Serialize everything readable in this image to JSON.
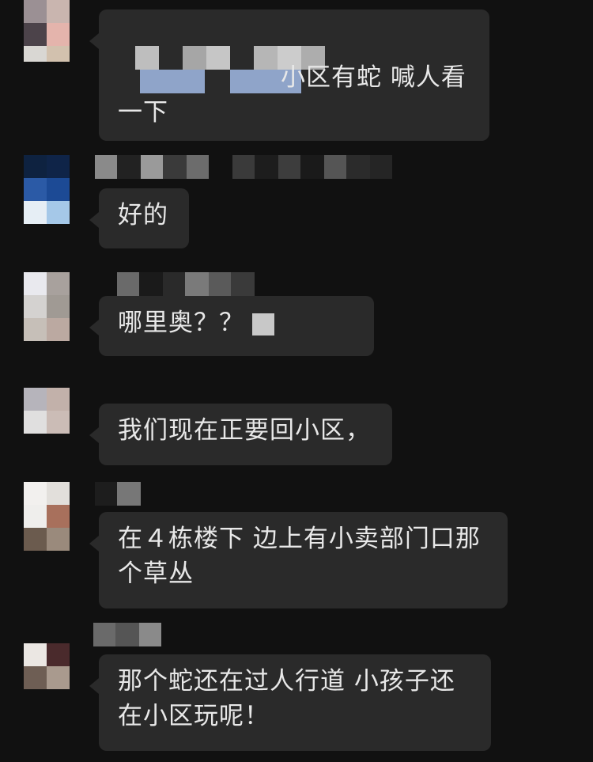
{
  "messages": [
    {
      "text_line1": "小区有蛇 喊人看",
      "text_line2": "一下"
    },
    {
      "text": "好的"
    },
    {
      "text": "哪里奥？？"
    },
    {
      "text": "我们现在正要回小区，"
    },
    {
      "text_line1": "在４栋楼下 边上有小卖部门口那",
      "text_line2": "个草丛"
    },
    {
      "text_line1": "那个蛇还在过人行道  小孩子还",
      "text_line2": "在小区玩呢！"
    }
  ],
  "colors": {
    "background": "#111111",
    "bubble": "#2a2a2a",
    "text": "#e8e8e8"
  }
}
